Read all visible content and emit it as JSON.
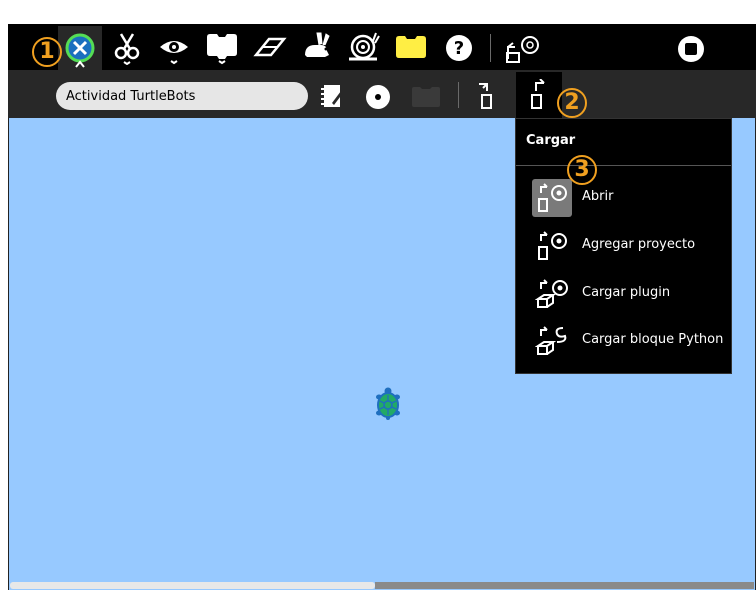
{
  "activity": {
    "title": "Actividad TurtleBots"
  },
  "toolbar": {
    "buttons": [
      "activity-button",
      "edit-cut",
      "view-toggle",
      "palette",
      "eraser",
      "run-fast",
      "run-slow",
      "step-bulb",
      "help",
      "load"
    ],
    "stop_icon": "stop-icon"
  },
  "callouts": [
    "1",
    "2",
    "3"
  ],
  "menu": {
    "title": "Cargar",
    "items": [
      {
        "label": "Abrir",
        "icon": "open-icon"
      },
      {
        "label": "Agregar proyecto",
        "icon": "add-project-icon"
      },
      {
        "label": "Cargar plugin",
        "icon": "load-plugin-icon"
      },
      {
        "label": "Cargar bloque Python",
        "icon": "load-python-icon"
      }
    ]
  },
  "colors": {
    "canvas": "#97c9ff",
    "toolbar": "#000000",
    "subtoolbar": "#282828",
    "accent": "#f0a020"
  }
}
